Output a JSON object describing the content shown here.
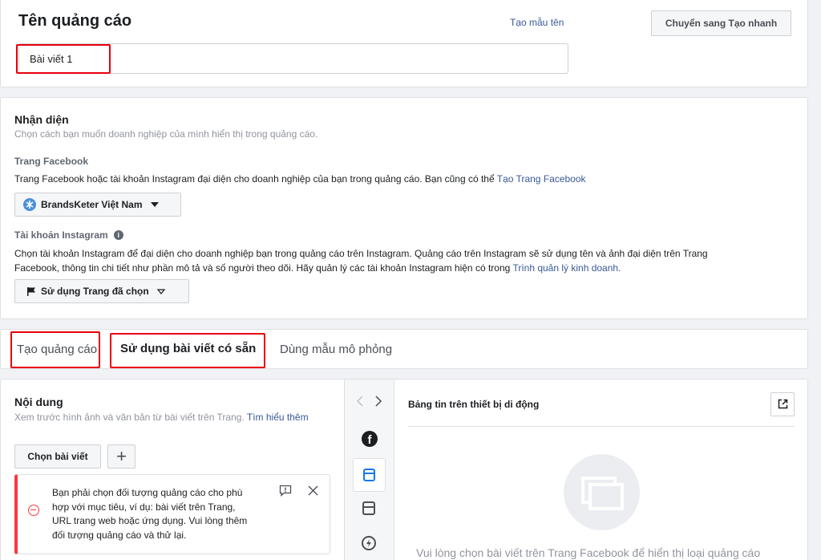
{
  "ad_name": {
    "title": "Tên quảng cáo",
    "template_link": "Tạo mẫu tên",
    "quick_button": "Chuyển sang Tạo nhanh",
    "input_value": "Bài viết 1"
  },
  "identity": {
    "title": "Nhận diện",
    "subtitle": "Chọn cách bạn muốn doanh nghiệp của mình hiển thị trong quảng cáo.",
    "fb_label": "Trang Facebook",
    "fb_desc": "Trang Facebook hoặc tài khoản Instagram đại diện cho doanh nghiệp của bạn trong quảng cáo. Bạn cũng có thể",
    "fb_link": "Tạo Trang Facebook",
    "page_selected": "BrandsKeter Việt Nam",
    "ig_label": "Tài khoản Instagram",
    "ig_desc_line1": "Chọn tài khoản Instagram để đại diện cho doanh nghiệp bạn trong quảng cáo trên Instagram. Quảng cáo trên Instagram sẽ sử dụng tên và ảnh đại diện trên Trang",
    "ig_desc_line2": "Facebook, thông tin chi tiết như phần mô tả và số người theo dõi. Hãy quản lý các tài khoản Instagram hiện có trong",
    "ig_link": "Trình quản lý kinh doanh.",
    "ig_selected": "Sử dụng Trang đã chọn"
  },
  "tabs": [
    {
      "label": "Tạo quảng cáo"
    },
    {
      "label": "Sử dụng bài viết có sẵn"
    },
    {
      "label": "Dùng mẫu mô phỏng"
    }
  ],
  "content": {
    "title": "Nội dung",
    "subtitle": "Xem trước hình ảnh và văn bản từ bài viết trên Trang.",
    "learn_more": "Tìm hiểu thêm",
    "choose_post": "Chọn bài viết",
    "add_symbol": "+",
    "error_text": "Bạn phải chọn đối tượng quảng cáo cho phù hợp với mục tiêu, ví dụ: bài viết trên Trang, URL trang web hoặc ứng dụng. Vui lòng thêm đối tượng quảng cáo và thử lại."
  },
  "preview": {
    "title": "Bảng tin trên thiết bị di động",
    "empty_message": "Vui lòng chọn bài viết trên Trang Facebook để hiển thị loại quảng cáo"
  },
  "icons": {
    "accent": "#385898",
    "error": "#fa383e"
  }
}
